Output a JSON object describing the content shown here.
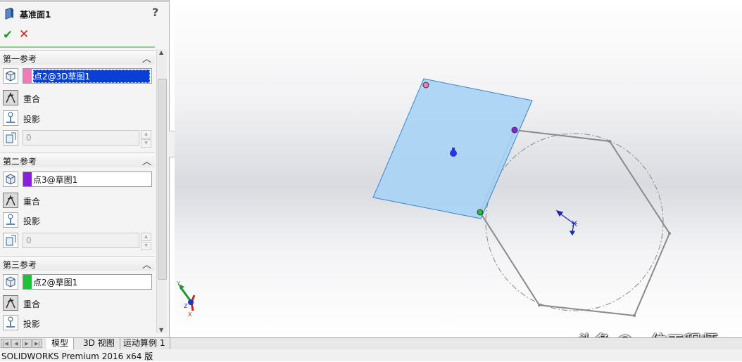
{
  "property_manager": {
    "title": "基准面1",
    "help": "?",
    "ok_glyph": "✔",
    "cancel_glyph": "✕",
    "sections": [
      {
        "header": "第一参考",
        "reference": "点2@3D草图1",
        "swatch_color": "#f07bb8",
        "options": [
          "重合",
          "投影"
        ],
        "number": "0"
      },
      {
        "header": "第二参考",
        "reference": "点3@草图1",
        "swatch_color": "#8a1ee0",
        "options": [
          "重合",
          "投影"
        ],
        "number": "0"
      },
      {
        "header": "第三参考",
        "reference": "点2@草图1",
        "swatch_color": "#1ec23a",
        "options": [
          "重合",
          "投影"
        ]
      }
    ]
  },
  "tabs": {
    "items": [
      "模型",
      "3D 视图",
      "运动算例 1"
    ],
    "active": "模型"
  },
  "status": {
    "text": "SOLIDWORKS Premium 2016 x64 版"
  },
  "triad": {
    "x": "X",
    "y": "Y",
    "z": "Z"
  },
  "watermark": "头条 @一位工程师",
  "colors": {
    "plane_fill": "#a9d3f5",
    "plane_edge": "#3a86c8",
    "sketch_line": "#8a8a8a"
  }
}
